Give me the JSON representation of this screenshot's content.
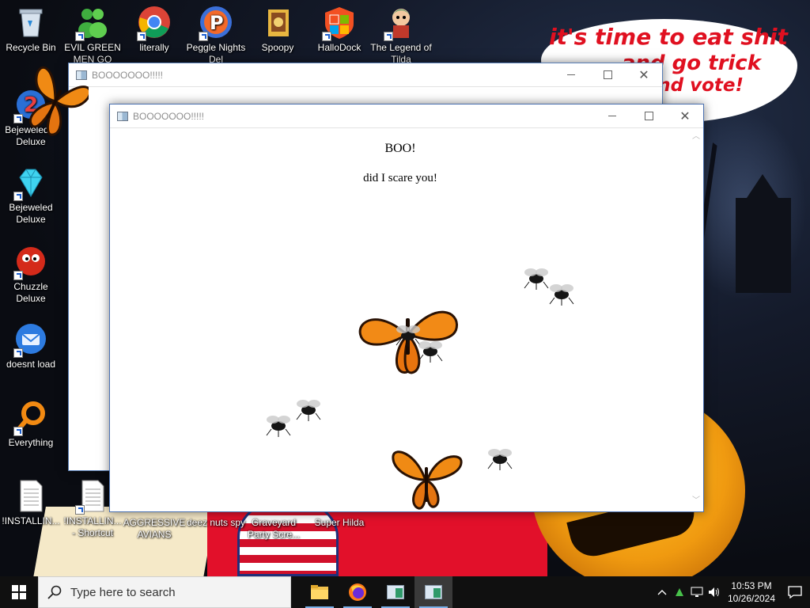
{
  "wallpaper": {
    "speech_line1": "it's time to eat shit",
    "speech_line2": "and go trick",
    "speech_line3": "and vote!"
  },
  "desktop_icons_top": [
    {
      "label": "Recycle Bin",
      "icon": "recycle-bin-icon"
    },
    {
      "label": "EVIL GREEN MEN GO",
      "icon": "green-men-icon"
    },
    {
      "label": "literally",
      "icon": "chrome-icon"
    },
    {
      "label": "Peggle Nights Del",
      "icon": "peggle-icon"
    },
    {
      "label": "Spoopy",
      "icon": "folder-icon"
    },
    {
      "label": "HalloDock",
      "icon": "windows-logo-icon"
    },
    {
      "label": "The Legend of Tilda",
      "icon": "character-icon"
    }
  ],
  "desktop_icons_left": [
    {
      "label": "Bejeweled 2 Deluxe",
      "icon": "bejeweled2-icon"
    },
    {
      "label": "Bejeweled Deluxe",
      "icon": "diamond-icon"
    },
    {
      "label": "Chuzzle Deluxe",
      "icon": "chuzzle-icon"
    },
    {
      "label": "doesnt load",
      "icon": "thunderbird-icon"
    },
    {
      "label": "Everything",
      "icon": "everything-search-icon"
    }
  ],
  "desktop_icons_bottom": [
    {
      "label": "!INSTALLIN...",
      "icon": "text-file-icon"
    },
    {
      "label": "!INSTALLIN... - Shortcut",
      "icon": "text-file-icon"
    },
    {
      "label": "AGGRESSIVE AVIANS"
    },
    {
      "label": "deez nuts spy"
    },
    {
      "label": "Graveyard Party Scre..."
    },
    {
      "label": "Super Hilda"
    }
  ],
  "windows": {
    "back": {
      "title": "BOOOOOOO!!!!!"
    },
    "front": {
      "title": "BOOOOOOO!!!!!",
      "heading": "BOO!",
      "message": "did I scare you!"
    }
  },
  "taskbar": {
    "search_placeholder": "Type here to search",
    "apps": [
      "file-explorer-icon",
      "firefox-icon",
      "app-window-icon",
      "app-window-active-icon"
    ],
    "time": "10:53 PM",
    "date": "10/26/2024"
  },
  "colors": {
    "speech_text": "#e01020",
    "taskbar": "#101010",
    "window_border": "#5a7fb6"
  }
}
